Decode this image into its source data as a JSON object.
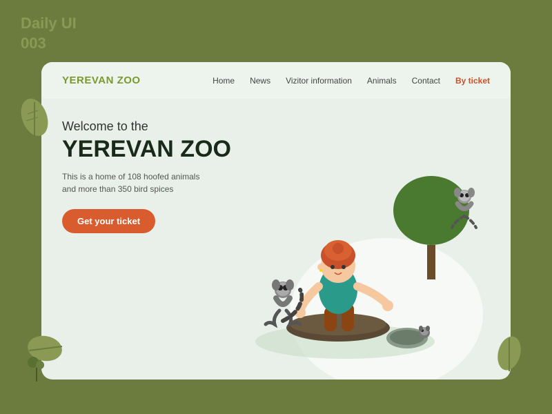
{
  "daily_ui": {
    "label": "Daily UI\n003"
  },
  "navbar": {
    "logo": "YEREVAN ZOO",
    "links": [
      {
        "id": "home",
        "label": "Home",
        "active": false
      },
      {
        "id": "news",
        "label": "News",
        "active": false
      },
      {
        "id": "visitor",
        "label": "Vizitor information",
        "active": false
      },
      {
        "id": "animals",
        "label": "Animals",
        "active": false
      },
      {
        "id": "contact",
        "label": "Contact",
        "active": false
      },
      {
        "id": "ticket",
        "label": "By ticket",
        "active": true
      }
    ]
  },
  "hero": {
    "welcome": "Welcome to the",
    "title": "YEREVAN ZOO",
    "description": "This is a home of 108 hoofed animals\nand more than 350 bird spices",
    "cta_label": "Get your ticket"
  },
  "colors": {
    "bg": "#6b7c3e",
    "card_bg": "#e8f0e9",
    "logo": "#7a9a2e",
    "cta": "#d95c2e",
    "active_nav": "#c8502a",
    "tree": "#4a7a30"
  }
}
